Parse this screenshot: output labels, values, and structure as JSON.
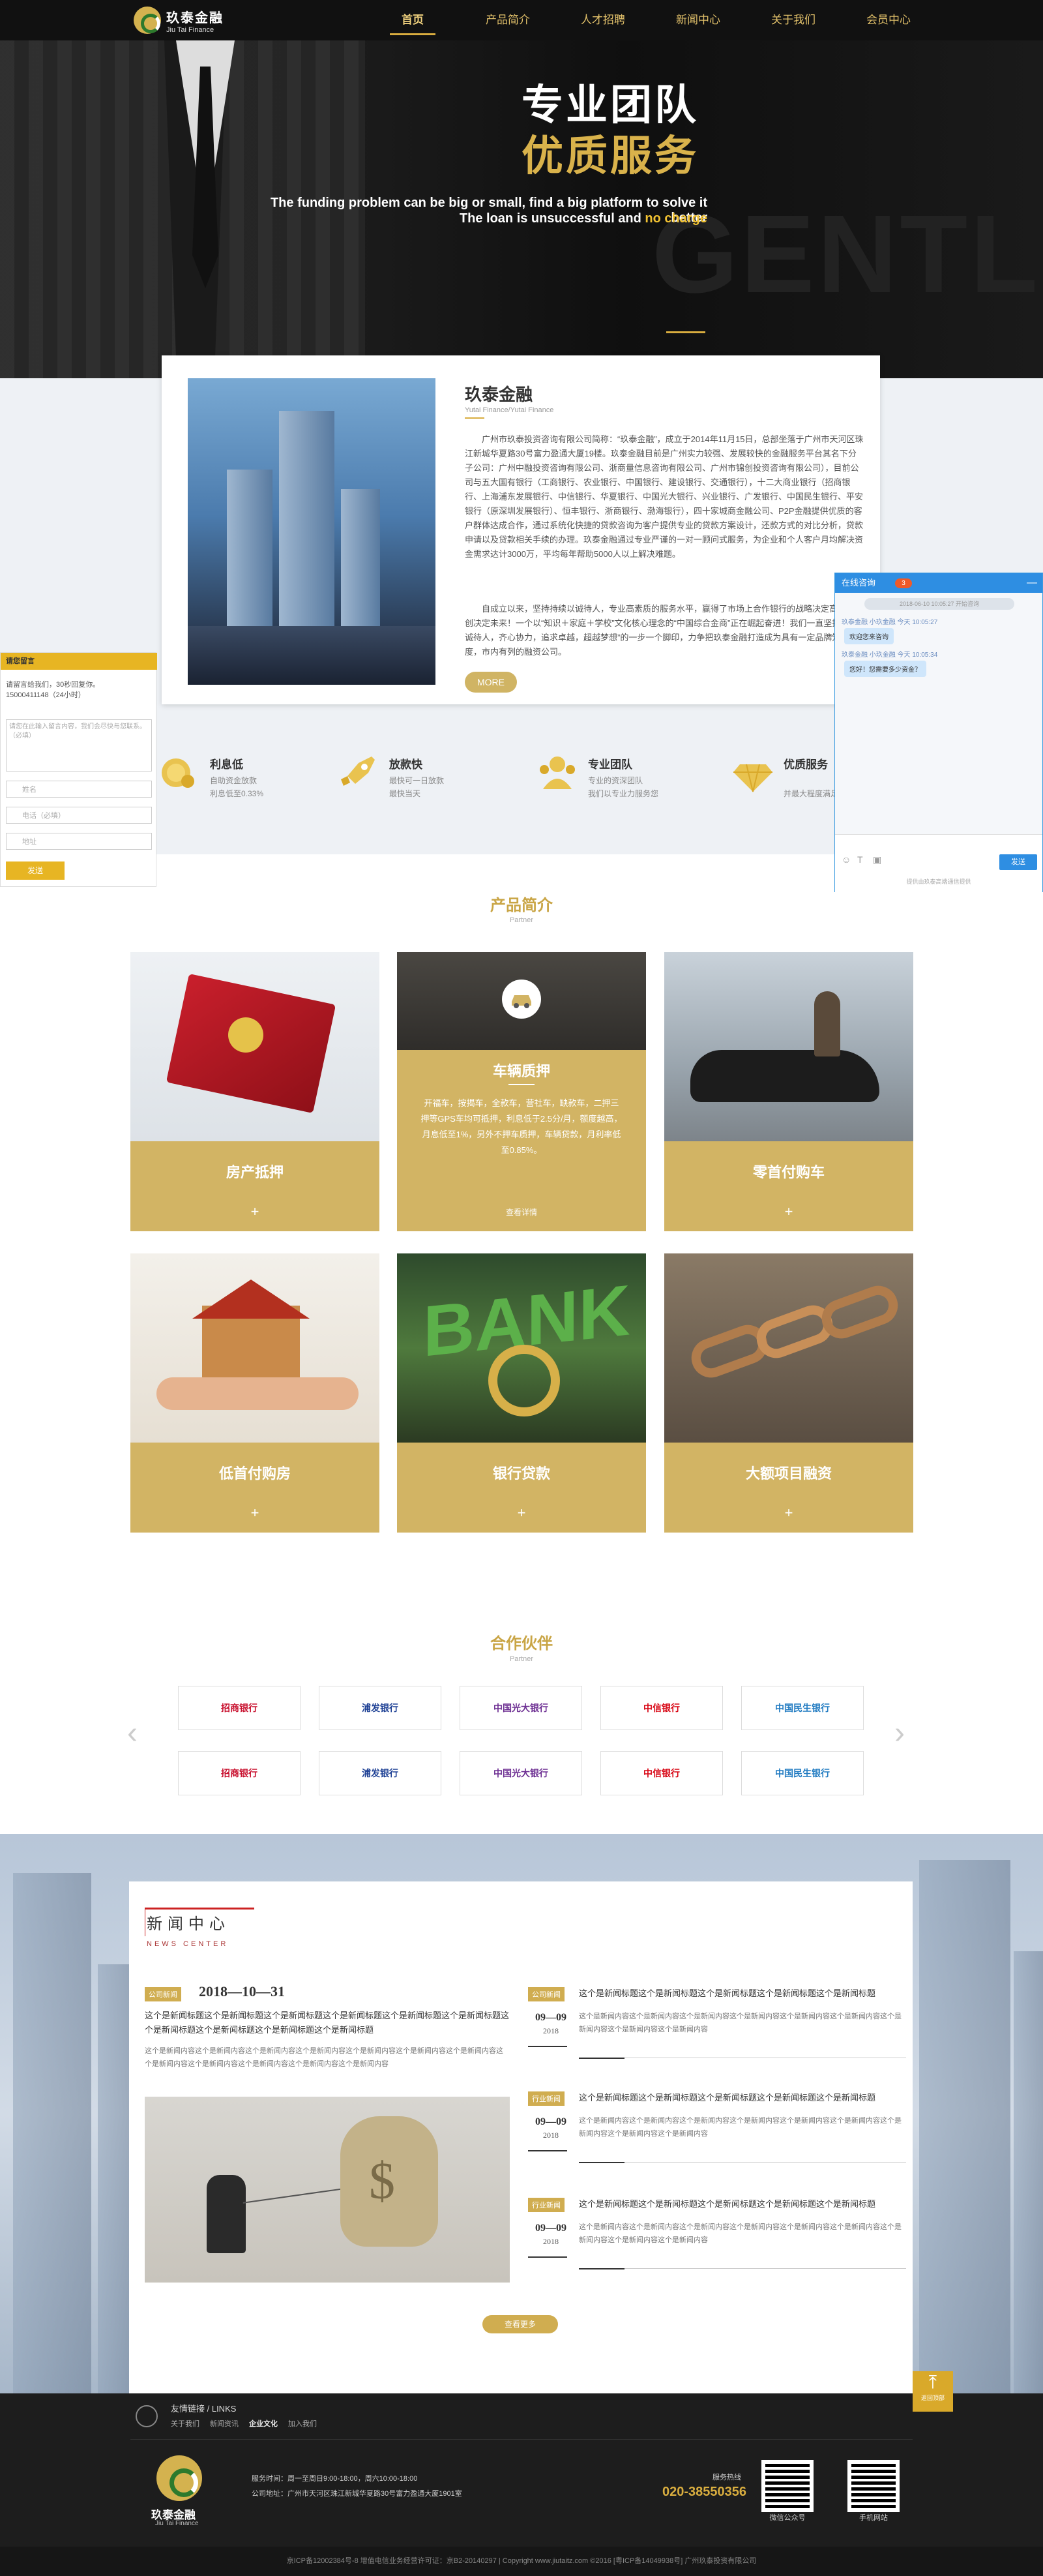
{
  "header": {
    "logo_cn": "玖泰金融",
    "logo_en": "Jiu Tai Finance",
    "nav": [
      {
        "label": "首页"
      },
      {
        "label": "产品简介"
      },
      {
        "label": "人才招聘"
      },
      {
        "label": "新闻中心"
      },
      {
        "label": "关于我们"
      },
      {
        "label": "会员中心"
      }
    ]
  },
  "banner": {
    "title1": "专业团队",
    "title2": "优质服务",
    "en_line1": "The funding problem can be big or small, find a big platform to solve it better",
    "en_line2_prefix": "The loan is unsuccessful and ",
    "en_line2_highlight": "no charge",
    "bg_word": "GENTLE"
  },
  "about": {
    "title": "玖泰金融",
    "subtitle": "Yutai Finance/Yutai Finance",
    "p1": "广州市玖泰投资咨询有限公司简称：“玖泰金融”，成立于2014年11月15日，总部坐落于广州市天河区珠江新城华夏路30号富力盈通大厦19楼。玖泰金融目前是广州实力较强、发展较快的金融服务平台其名下分子公司：广州中融投资咨询有限公司、浙商量信息咨询有限公司、广州市锦创投资咨询有限公司），目前公司与五大国有银行（工商银行、农业银行、中国银行、建设银行、交通银行），十二大商业银行（招商银行、上海浦东发展银行、中信银行、华夏银行、中国光大银行、兴业银行、广发银行、中国民生银行、平安银行（原深圳发展银行）、恒丰银行、浙商银行、渤海银行），四十家城商金融公司、P2P金融提供优质的客户群体达成合作，通过系统化快捷的贷款咨询为客户提供专业的贷款方案设计，还款方式的对比分析，贷款申请以及贷款相关手续的办理。玖泰金融通过专业严谨的一对一顾问式服务，为企业和个人客户月均解决资金需求达计3000万，平均每年帮助5000人以上解决难题。",
    "p2": "自成立以来，坚持持续以诚待人，专业高素质的服务水平，赢得了市场上合作银行的战略决定高度，并创决定未来！一个以“知识＋家庭＋学校”文化核心理念的“中国综合金商”正在崛起奋进！我们一直坚持着“以诚待人，齐心协力，追求卓越，超越梦想”的一步一个脚印，力争把玖泰金融打造成为具有一定品牌知名度，市内有列的融资公司。",
    "more_label": "MORE"
  },
  "features": [
    {
      "title": "利息低",
      "line1": "自助资金放款",
      "line2": "利息低至0.33%"
    },
    {
      "title": "放款快",
      "line1": "最快可一日放款",
      "line2": "最快当天"
    },
    {
      "title": "专业团队",
      "line1": "专业的资深团队",
      "line2": "我们以专业力服务您"
    },
    {
      "title": "优质服务",
      "line1": "",
      "line2": "并最大程度满足"
    }
  ],
  "products": {
    "title": "产品简介",
    "subtitle": "Partner",
    "items": [
      {
        "label": "房产抵押",
        "plus": "+"
      },
      {
        "label": "车辆质押",
        "plus": "+",
        "desc": "开福车，按揭车，全款车，营社车，缺款车，二押三押等GPS车均可抵押，利息低于2.5分/月，额度越高，月息低至1%，另外不押车质押，车辆贷款，月利率低至0.85%。",
        "btn": "查看详情"
      },
      {
        "label": "零首付购车",
        "plus": "+"
      },
      {
        "label": "低首付购房",
        "plus": "+"
      },
      {
        "label": "银行贷款",
        "plus": "+"
      },
      {
        "label": "大额项目融资",
        "plus": "+"
      }
    ]
  },
  "partners": {
    "title": "合作伙伴",
    "subtitle": "Partner",
    "prev": "‹",
    "next": "›",
    "row1": [
      {
        "name": "招商银行",
        "color": "#c8102e"
      },
      {
        "name": "浦发银行",
        "color": "#1c3f94"
      },
      {
        "name": "中国光大银行",
        "color": "#6b2c91"
      },
      {
        "name": "中信银行",
        "color": "#d7000f"
      },
      {
        "name": "中国民生银行",
        "color": "#1f7ac1"
      }
    ],
    "row2": [
      {
        "name": "招商银行",
        "color": "#c8102e"
      },
      {
        "name": "浦发银行",
        "color": "#1c3f94"
      },
      {
        "name": "中国光大银行",
        "color": "#6b2c91"
      },
      {
        "name": "中信银行",
        "color": "#d7000f"
      },
      {
        "name": "中国民生银行",
        "color": "#1f7ac1"
      }
    ]
  },
  "news": {
    "title": "新闻中心",
    "subtitle": "NEWS CENTER",
    "featured": {
      "tag": "公司新闻",
      "date": "2018—10—31",
      "title": "这个是新闻标题这个是新闻标题这个是新闻标题这个是新闻标题这个是新闻标题这个是新闻标题这个是新闻标题这个是新闻标题这个是新闻标题这个是新闻标题",
      "desc": "这个是新闻内容这个是新闻内容这个是新闻内容这个是新闻内容这个是新闻内容这个是新闻内容这个是新闻内容这个是新闻内容这个是新闻内容这个是新闻内容这个是新闻内容这个是新闻内容"
    },
    "items": [
      {
        "tag": "公司新闻",
        "date": "09—09",
        "year": "2018",
        "title": "这个是新闻标题这个是新闻标题这个是新闻标题这个是新闻标题这个是新闻标题",
        "desc": "这个是新闻内容这个是新闻内容这个是新闻内容这个是新闻内容这个是新闻内容这个是新闻内容这个是新闻内容这个是新闻内容这个是新闻内容"
      },
      {
        "tag": "行业新闻",
        "date": "09—09",
        "year": "2018",
        "title": "这个是新闻标题这个是新闻标题这个是新闻标题这个是新闻标题这个是新闻标题",
        "desc": "这个是新闻内容这个是新闻内容这个是新闻内容这个是新闻内容这个是新闻内容这个是新闻内容这个是新闻内容这个是新闻内容这个是新闻内容"
      },
      {
        "tag": "行业新闻",
        "date": "09—09",
        "year": "2018",
        "title": "这个是新闻标题这个是新闻标题这个是新闻标题这个是新闻标题这个是新闻标题",
        "desc": "这个是新闻内容这个是新闻内容这个是新闻内容这个是新闻内容这个是新闻内容这个是新闻内容这个是新闻内容这个是新闻内容这个是新闻内容"
      }
    ],
    "more_label": "查看更多"
  },
  "footer": {
    "links_title": "友情链接 / LINKS",
    "links": [
      "关于我们",
      "新闻资讯",
      "企业文化",
      "加入我们"
    ],
    "name": "玖泰金融",
    "name_en": "Jiu Tai Finance",
    "hours": "服务时间：周一至周日9:00-18:00，周六10:00-18:00",
    "address": "公司地址：广州市天河区珠江新城华夏路30号富力盈通大厦1901室",
    "hotline_label": "服务热线",
    "phone": "020-38550356",
    "qr1_label": "微信公众号",
    "qr2_label": "手机网站",
    "copyright": "京ICP备12002384号-8  增值电信业务经营许可证：京B2-20140297  |  Copyright www.jiutaitz.com ©2016 [粤ICP备14049938号] 广州玖泰投资有限公司"
  },
  "left_form": {
    "header": "请您留言",
    "line1": "请留言给我们，30秒回复你。",
    "line2": "15000411148（24小时）",
    "textarea_placeholder": "请您在此输入留言内容，我们会尽快与您联系。（必填）",
    "name_placeholder": "姓名",
    "phone_placeholder": "电话（必填）",
    "address_placeholder": "地址",
    "send_label": "发送"
  },
  "chat": {
    "title": "在线咨询",
    "badge": "3",
    "min": "—",
    "system_msg": "2018-06-10 10:05:27 开始咨询",
    "meta1": "玖泰金融 小玖金融  今天 10:05:27",
    "msg1": "欢迎您来咨询",
    "meta2": "玖泰金融 小玖金融  今天 10:05:34",
    "msg2": "您好！您需要多少资金？",
    "send_label": "发送",
    "footer": "提供由玖泰高端通信提供"
  },
  "totop": {
    "arrow": "⤒",
    "label": "返回顶部"
  }
}
